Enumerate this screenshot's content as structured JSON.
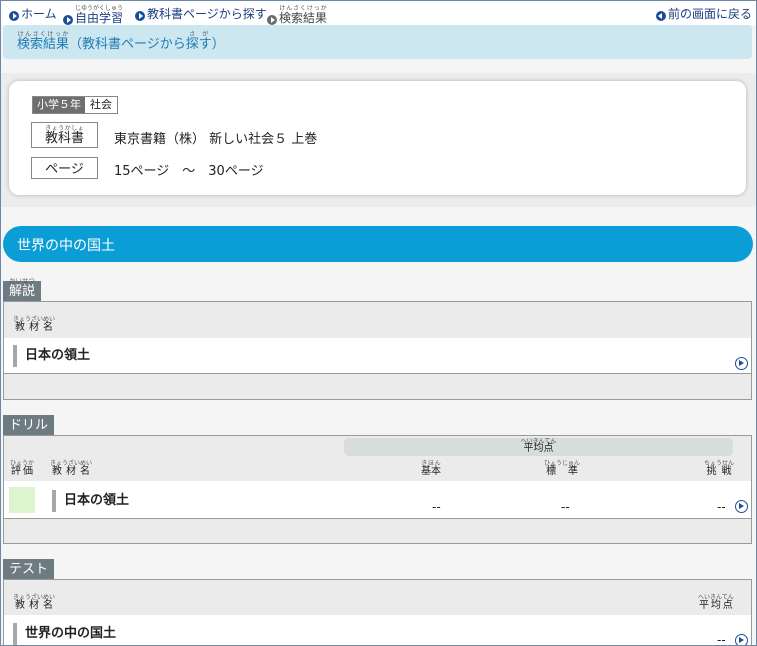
{
  "nav": {
    "home": "ホーム",
    "free_study": "自由学習",
    "free_study_ruby": "じゆうがくしゅう",
    "textbook_search": "教科書ページから探す",
    "textbook_ruby": "きょうかしょ",
    "search_ruby": "さが",
    "results": "検索結果",
    "results_ruby": "けんさくけっか",
    "back": "前の画面に戻る",
    "back_ruby_1": "まえ",
    "back_ruby_2": "がめん",
    "back_ruby_3": "もど"
  },
  "result_bar": {
    "title_prefix": "検索結果",
    "title_ruby": "けんさくけっか",
    "title_middle": "（教科書ページから",
    "title_mid_ruby": "きょうかしょ",
    "title_search": "探す",
    "title_search_ruby": "さが",
    "title_suffix": "）"
  },
  "info": {
    "grade": "小学５年",
    "subject": "社会",
    "textbook_label": "教科書",
    "textbook_label_ruby": "きょうかしょ",
    "textbook_value": "東京書籍（株）  新しい社会５  上巻",
    "page_label": "ページ",
    "page_value": "15ページ　～　30ページ"
  },
  "section": {
    "title": "世界の中の国土"
  },
  "kaisetsu": {
    "tab": "解説",
    "tab_ruby": "かいせつ",
    "col_name": "教材名",
    "col_name_ruby": "きょうざいめい",
    "items": [
      {
        "name": "日本の領土"
      }
    ]
  },
  "drill": {
    "tab": "ドリル",
    "avg_label": "平均点",
    "avg_ruby": "へいきんてん",
    "col_eval": "評価",
    "col_eval_ruby": "ひょうか",
    "col_name": "教材名",
    "col_name_ruby": "きょうざいめい",
    "col_basic": "基本",
    "col_basic_ruby": "きほん",
    "col_standard": "標 準",
    "col_standard_ruby": "ひょうじゅん",
    "col_challenge": "挑戦",
    "col_challenge_ruby": "ちょうせん",
    "items": [
      {
        "name": "日本の領土",
        "basic": "--",
        "standard": "--",
        "challenge": "--"
      }
    ]
  },
  "test": {
    "tab": "テスト",
    "col_name": "教材名",
    "col_name_ruby": "きょうざいめい",
    "col_avg": "平均点",
    "col_avg_ruby": "へいきんてん",
    "items": [
      {
        "name": "世界の中の国土",
        "avg": "--"
      }
    ]
  },
  "colors": {
    "nav_blue": "#1d4d9a",
    "section_blue": "#0b9ed6",
    "result_bar": "#cde7f1",
    "tab_gray": "#6f7b82"
  }
}
